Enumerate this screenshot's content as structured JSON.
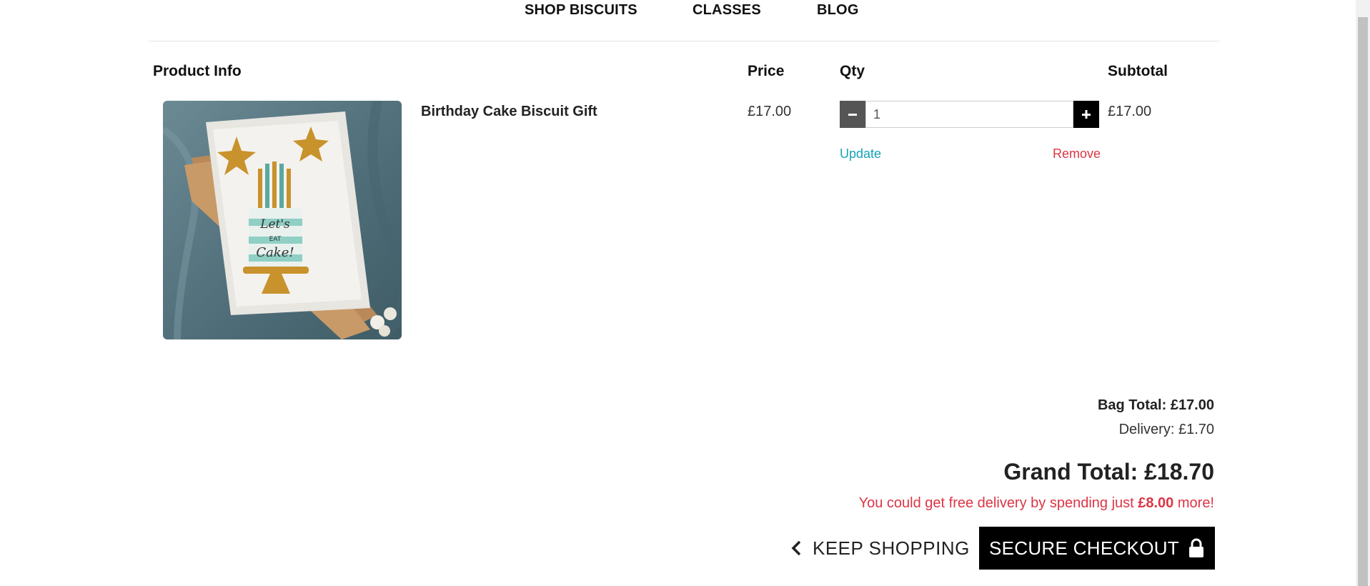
{
  "nav": {
    "shop": "SHOP BISCUITS",
    "classes": "CLASSES",
    "blog": "BLOG"
  },
  "table": {
    "headers": {
      "product": "Product Info",
      "price": "Price",
      "qty": "Qty",
      "subtotal": "Subtotal"
    },
    "items": [
      {
        "name": "Birthday Cake Biscuit Gift",
        "price": "£17.00",
        "qty": "1",
        "subtotal": "£17.00",
        "update": "Update",
        "remove": "Remove"
      }
    ]
  },
  "totals": {
    "bag_total": "Bag Total: £17.00",
    "delivery": "Delivery: £1.70",
    "grand_total": "Grand Total: £18.70",
    "free_prefix": "You could get free delivery by spending just ",
    "free_amount": "£8.00",
    "free_suffix": " more!"
  },
  "actions": {
    "keep_shopping": "KEEP SHOPPING",
    "checkout": "SECURE CHECKOUT"
  },
  "icons": {
    "minus": "minus-icon",
    "plus": "plus-icon",
    "chevron": "chevron-left-icon",
    "lock": "lock-icon"
  },
  "colors": {
    "update_link": "#17a2b8",
    "remove_link": "#dc3545",
    "checkout_bg": "#000000"
  }
}
